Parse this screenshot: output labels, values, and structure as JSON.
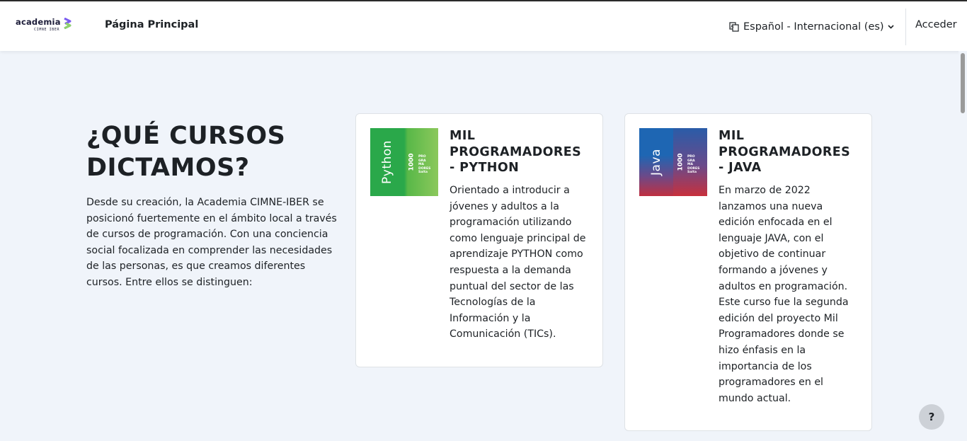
{
  "navbar": {
    "logo_text": "academia",
    "logo_subtext": "CIMNE IBER",
    "home_label": "Página Principal",
    "language_label": "Español - Internacional (es)",
    "login_label": "Acceder"
  },
  "hero": {
    "title": "¿QUÉ CURSOS DICTAMOS?",
    "description": "Desde su creación, la Academia CIMNE-IBER se posicionó fuertemente en el ámbito local a través de cursos de programación. Con una conciencia social focalizada en comprender las necesidades de las personas, es que creamos diferentes cursos. Entre ellos se distinguen:"
  },
  "courses": [
    {
      "title": "MIL PROGRAMADORES - PYTHON",
      "description": "Orientado a introducir a jóvenes y adultos a la programación utilizando como lenguaje principal de aprendizaje PYTHON como respuesta a la demanda puntual del sector de las Tecnologías de la Información y la Comunicación (TICs).",
      "thumb_label": "Python",
      "thumb_number": "1000",
      "thumb_lines": [
        "PRO",
        "GRA",
        "MA",
        "DORES",
        "Salta"
      ]
    },
    {
      "title": "MIL PROGRAMADORES - JAVA",
      "description": "En marzo de 2022 lanzamos una nueva edición enfocada en el lenguaje JAVA, con el objetivo de continuar formando a jóvenes y adultos en programación. Este curso fue la segunda edición del proyecto Mil Programadores donde se hizo énfasis en la importancia de los programadores en el mundo actual.",
      "thumb_label": "Java",
      "thumb_number": "1000",
      "thumb_lines": [
        "PRO",
        "GRA",
        "MA",
        "DORES",
        "Salta"
      ]
    }
  ],
  "help_button": {
    "label": "?"
  },
  "colors": {
    "page_background": "#f0f4fa",
    "python_green": "#2aa84a",
    "java_blue": "#1e66b3",
    "text": "#1d2125"
  }
}
